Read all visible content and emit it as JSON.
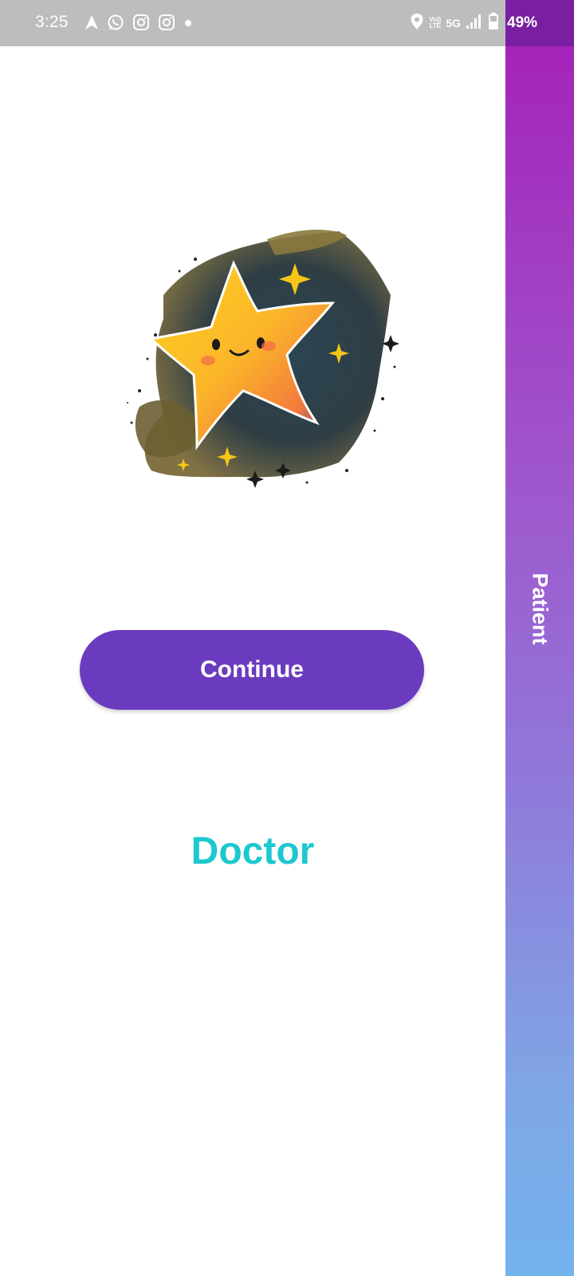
{
  "status_bar": {
    "time": "3:25",
    "left_icons": [
      "navigation-icon",
      "whatsapp-icon",
      "instagram-icon",
      "instagram-icon",
      "dot-icon"
    ],
    "right_icons": [
      "location-icon",
      "volte-icon",
      "signal-icon",
      "battery-icon"
    ],
    "volte_line1": "Vo))",
    "volte_line2": "LTE",
    "network": "5G",
    "battery": "49%",
    "bg_color": "#bdbdbd",
    "battery_area_color": "#7b1fa2"
  },
  "side_panel": {
    "label": "Patient",
    "gradient_top": "#a424b9",
    "gradient_bottom": "#73b3ee"
  },
  "illustration": {
    "icon": "star-character-icon"
  },
  "main": {
    "continue_label": "Continue",
    "continue_color": "#6b3bbf",
    "doctor_label": "Doctor",
    "doctor_color": "#1dc8cf"
  }
}
